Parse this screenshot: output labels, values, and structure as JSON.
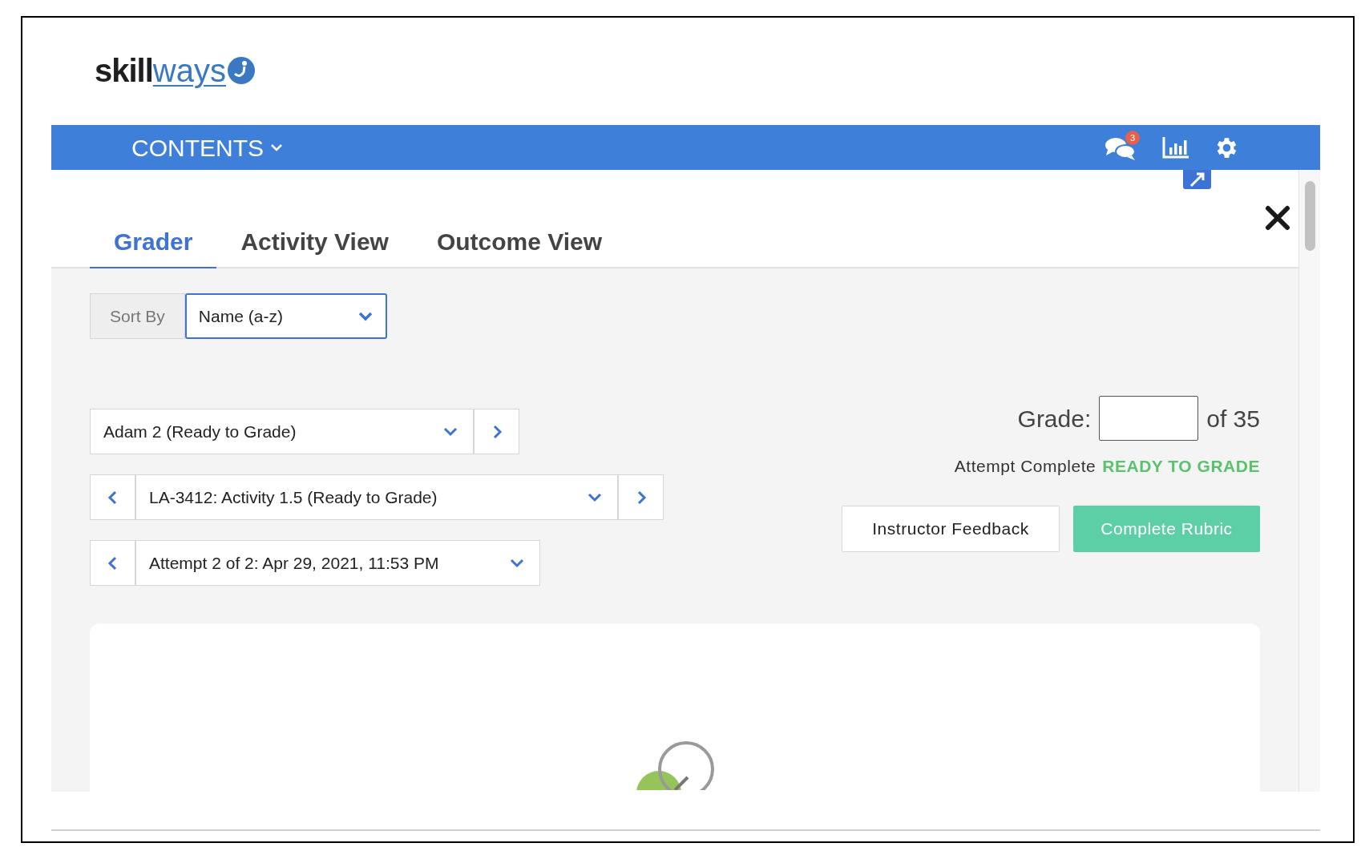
{
  "logo": {
    "dark_text": "skill",
    "light_text": "ways"
  },
  "top_bar": {
    "menu_label": "CONTENTS",
    "messages_badge": "3"
  },
  "tabs": [
    {
      "label": "Grader",
      "selected": true
    },
    {
      "label": "Activity View",
      "selected": false
    },
    {
      "label": "Outcome View",
      "selected": false
    }
  ],
  "sort": {
    "label": "Sort By",
    "value": "Name (a-z)"
  },
  "selectors": [
    {
      "value": "Adam 2 (Ready to Grade)",
      "prev": false,
      "next": true
    },
    {
      "value": "LA-3412: Activity 1.5 (Ready to Grade)",
      "prev": true,
      "next": true
    },
    {
      "value": "Attempt 2 of 2: Apr 29, 2021, 11:53 PM",
      "prev": true,
      "next": false
    }
  ],
  "grade": {
    "label": "Grade:",
    "out_of": "of 35"
  },
  "status": {
    "text": "Attempt Complete",
    "state": "READY TO GRADE"
  },
  "buttons": [
    {
      "label": "Instructor Feedback",
      "kind": "outline"
    },
    {
      "label": "Complete Rubric",
      "kind": "primary"
    }
  ]
}
